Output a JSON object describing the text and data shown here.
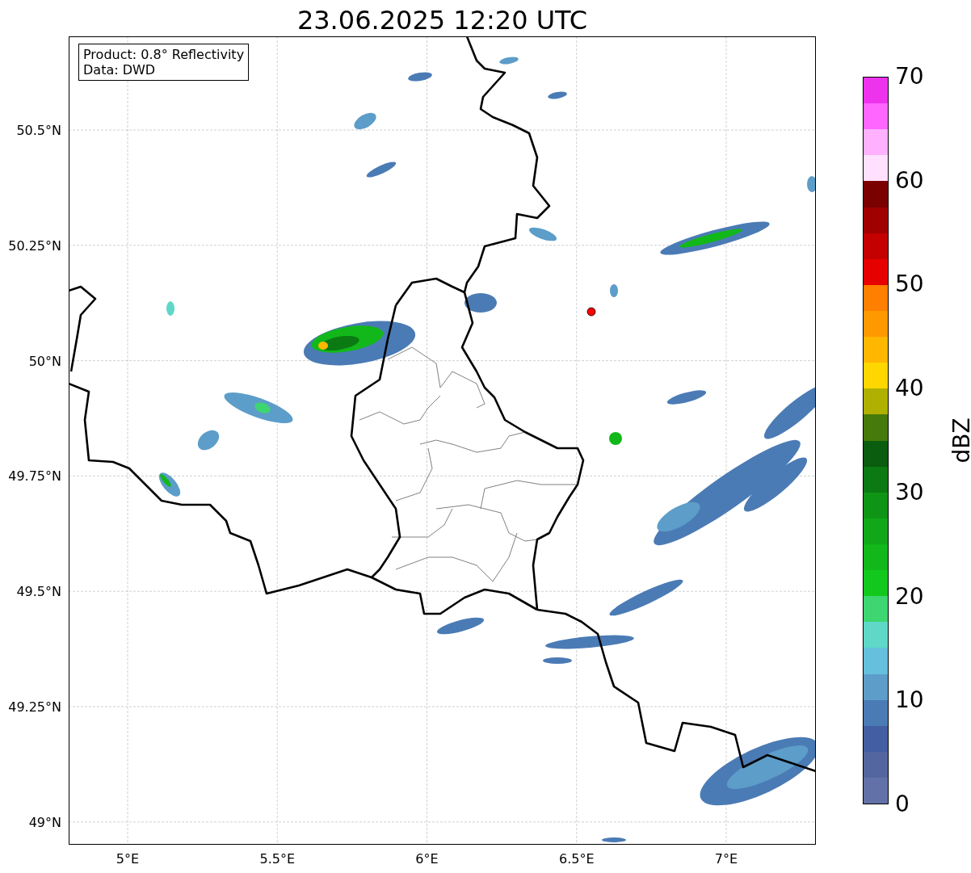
{
  "title": "23.06.2025 12:20 UTC",
  "annotation": [
    "Product: 0.8° Reflectivity",
    "Data: DWD"
  ],
  "map": {
    "xticks": [
      "5°E",
      "5.5°E",
      "6°E",
      "6.5°E",
      "7°E"
    ],
    "yticks": [
      "50.5°N",
      "50.25°N",
      "50°N",
      "49.75°N",
      "49.5°N",
      "49.25°N",
      "49°N"
    ]
  },
  "colorbar": {
    "label": "dBZ",
    "ticks": [
      "70",
      "60",
      "50",
      "40",
      "30",
      "20",
      "10",
      "0"
    ],
    "bins": [
      {
        "color": "#6272a8"
      },
      {
        "color": "#5466a0"
      },
      {
        "color": "#435ea3"
      },
      {
        "color": "#4b7bb5"
      },
      {
        "color": "#5c9dc9"
      },
      {
        "color": "#64c0dc"
      },
      {
        "color": "#5fd8c8"
      },
      {
        "color": "#3dd670"
      },
      {
        "color": "#12c81c"
      },
      {
        "color": "#12b81a"
      },
      {
        "color": "#10a818"
      },
      {
        "color": "#0f9516"
      },
      {
        "color": "#0b7a12"
      },
      {
        "color": "#0a5c0e"
      },
      {
        "color": "#467a0a"
      },
      {
        "color": "#b0b000"
      },
      {
        "color": "#ffd700"
      },
      {
        "color": "#ffb700"
      },
      {
        "color": "#ff9900"
      },
      {
        "color": "#ff7f00"
      },
      {
        "color": "#e60000"
      },
      {
        "color": "#c40000"
      },
      {
        "color": "#a00000"
      },
      {
        "color": "#7b0000"
      },
      {
        "color": "#ffe0ff"
      },
      {
        "color": "#ffb0ff"
      },
      {
        "color": "#ff66ff"
      },
      {
        "color": "#ee33ee"
      }
    ]
  }
}
